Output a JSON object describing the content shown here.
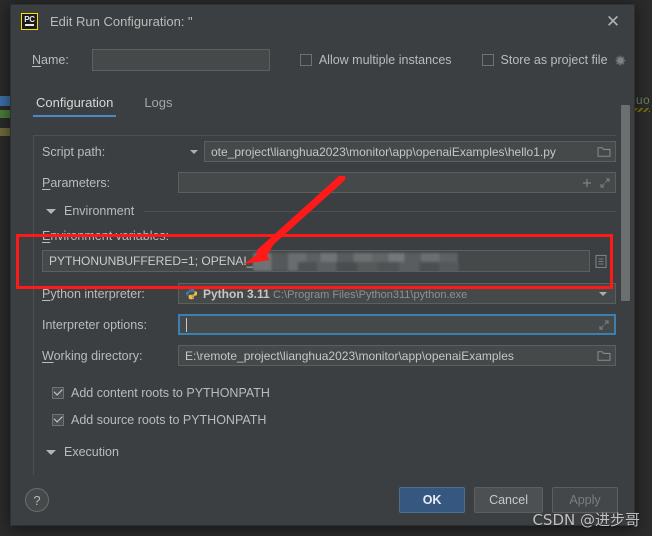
{
  "window": {
    "app_icon": "pycharm-pc-icon",
    "title": "Edit Run Configuration: \"",
    "close_icon": "close-icon"
  },
  "name_row": {
    "label": "Name:",
    "value": "",
    "allow_multiple": {
      "label": "Allow multiple instances",
      "checked": false
    },
    "store_as_project_file": {
      "label": "Store as project file",
      "checked": false,
      "gear_icon": "gear-icon"
    }
  },
  "tabs": [
    {
      "label": "Configuration",
      "active": true
    },
    {
      "label": "Logs",
      "active": false
    }
  ],
  "form": {
    "script_path": {
      "label": "Script path:",
      "value": "ote_project\\lianghua2023\\monitor\\app\\openaiExamples\\hello1.py",
      "dropdown_icon": "chevron-down-icon",
      "browse_icon": "folder-icon"
    },
    "parameters": {
      "label": "Parameters:",
      "value": "",
      "add_icon": "plus-icon",
      "expand_icon": "expand-icon"
    },
    "environment_section": {
      "label": "Environment",
      "collapse_icon": "triangle-down-icon"
    },
    "environment_variables": {
      "label": "Environment variables:",
      "value": "PYTHONUNBUFFERED=1; OPENAI_API_KEY=sk-xMjgB5sC",
      "redacted": true,
      "browse_icon": "list-icon"
    },
    "python_interpreter": {
      "label": "Python interpreter:",
      "icon": "python-logo-icon",
      "value": "Python 3.11",
      "path": "C:\\Program Files\\Python311\\python.exe",
      "dropdown_icon": "chevron-down-icon"
    },
    "interpreter_options": {
      "label": "Interpreter options:",
      "value": "",
      "focused": true,
      "expand_icon": "expand-icon"
    },
    "working_directory": {
      "label": "Working directory:",
      "value": "E:\\remote_project\\lianghua2023\\monitor\\app\\openaiExamples",
      "browse_icon": "folder-icon"
    },
    "add_content_roots": {
      "label": "Add content roots to PYTHONPATH",
      "checked": true
    },
    "add_source_roots": {
      "label": "Add source roots to PYTHONPATH",
      "checked": true
    },
    "execution_section": {
      "label": "Execution",
      "collapse_icon": "triangle-down-icon"
    }
  },
  "bottom": {
    "help_label": "?",
    "ok_label": "OK",
    "cancel_label": "Cancel",
    "apply_label": "Apply"
  },
  "annotation": {
    "highlight_color": "#ff1a1a",
    "arrow": "red-arrow-pointing-to-env-variables"
  },
  "watermark": {
    "text": "CSDN @进步哥"
  },
  "background": {
    "code_fragment": "uo"
  },
  "colors": {
    "dialog_bg": "#3c3f41",
    "field_bg": "#45494a",
    "accent_blue": "#4a88c7",
    "primary_button": "#365880",
    "annotation_red": "#ff1a1a"
  }
}
